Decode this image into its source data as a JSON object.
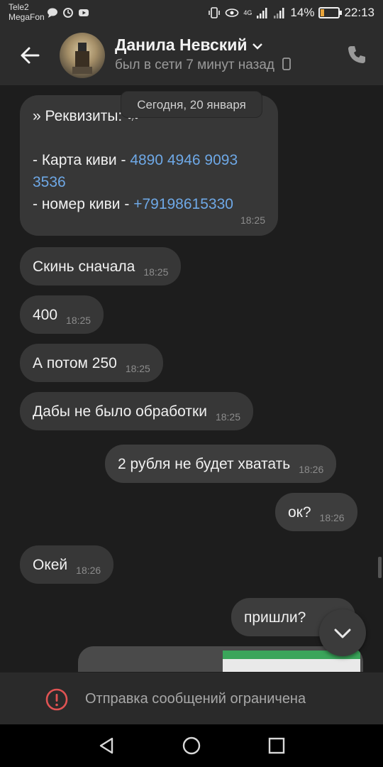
{
  "status_bar": {
    "carrier1": "Tele2",
    "carrier2": "MegaFon",
    "network": "4G",
    "battery": "14%",
    "time": "22:13"
  },
  "header": {
    "contact_name": "Данила Невский",
    "last_seen": "был в сети 7 минут назад"
  },
  "chat": {
    "date_pill": "Сегодня, 20 января",
    "messages": [
      {
        "direction": "in",
        "lines": [
          "» Реквизиты: ☘",
          "",
          "- Карта киви - ",
          "- номер киви - "
        ],
        "card": "4890 4946 9093 3536",
        "card_part1": "4890 4946 9093",
        "card_part2": "3536",
        "phone": "+79198615330",
        "time": "18:25"
      },
      {
        "direction": "in",
        "text": "Скинь сначала",
        "time": "18:25"
      },
      {
        "direction": "in",
        "text": "400",
        "time": "18:25"
      },
      {
        "direction": "in",
        "text": "А потом 250",
        "time": "18:25"
      },
      {
        "direction": "in",
        "text": "Дабы не было обработки",
        "time": "18:25"
      },
      {
        "direction": "out",
        "text": "2 рубля не будет хватать",
        "time": "18:26"
      },
      {
        "direction": "out",
        "text": "ок?",
        "time": "18:26"
      },
      {
        "direction": "in",
        "text": "Окей",
        "time": "18:26"
      },
      {
        "direction": "out",
        "text": "пришли?",
        "time": ""
      }
    ]
  },
  "restricted": {
    "text": "Отправка сообщений ограничена"
  },
  "colors": {
    "background": "#1d1d1d",
    "bubble": "#373737",
    "link": "#6ea8e6",
    "battery_fill": "#e9a43a"
  }
}
